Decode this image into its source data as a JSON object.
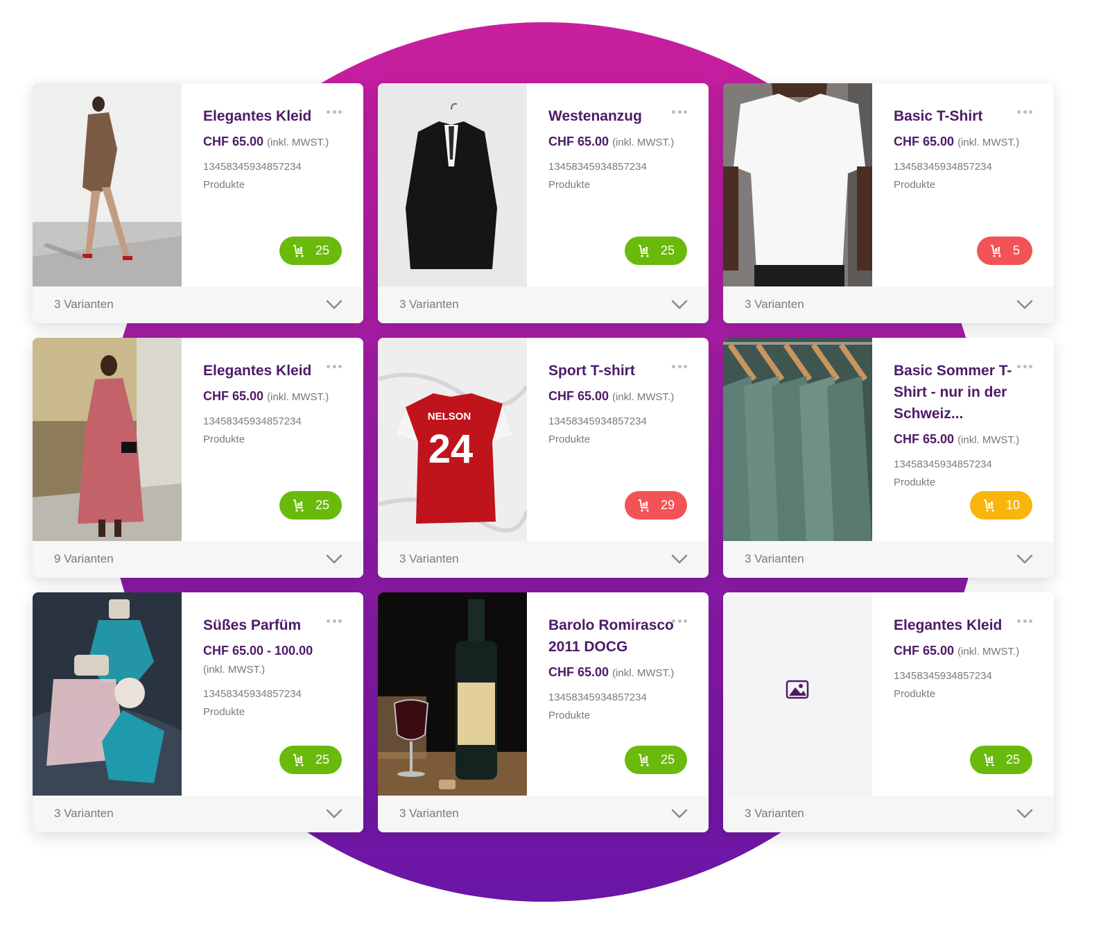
{
  "colors": {
    "accent": "#4e1a68",
    "stock_green": "#6aba0c",
    "stock_red": "#f25356",
    "stock_yellow": "#f8b50c",
    "background_gradient": [
      "#c91f9e",
      "#6a16a6"
    ]
  },
  "products": [
    {
      "title": "Elegantes Kleid",
      "price": "CHF 65.00",
      "tax": "(inkl. MWST.)",
      "sku": "13458345934857234",
      "category": "Produkte",
      "stock": "25",
      "stock_status": "green",
      "variants": "3 Varianten",
      "image": "woman-brown-dress-photo"
    },
    {
      "title": "Westenanzug",
      "price": "CHF 65.00",
      "tax": "(inkl. MWST.)",
      "sku": "13458345934857234",
      "category": "Produkte",
      "stock": "25",
      "stock_status": "green",
      "variants": "3 Varianten",
      "image": "black-suit-jacket-photo"
    },
    {
      "title": "Basic T-Shirt",
      "price": "CHF 65.00",
      "tax": "(inkl. MWST.)",
      "sku": "13458345934857234",
      "category": "Produkte",
      "stock": "5",
      "stock_status": "red",
      "variants": "3 Varianten",
      "image": "white-tshirt-photo"
    },
    {
      "title": "Elegantes Kleid",
      "price": "CHF 65.00",
      "tax": "(inkl. MWST.)",
      "sku": "13458345934857234",
      "category": "Produkte",
      "stock": "25",
      "stock_status": "green",
      "variants": "9 Varianten",
      "image": "woman-pink-dress-photo"
    },
    {
      "title": "Sport T-shirt",
      "price": "CHF 65.00",
      "tax": "(inkl. MWST.)",
      "sku": "13458345934857234",
      "category": "Produkte",
      "stock": "29",
      "stock_status": "red",
      "variants": "3 Varianten",
      "image": "red-jersey-photo",
      "jersey_name": "NELSON",
      "jersey_number": "24"
    },
    {
      "title": "Basic Sommer T-Shirt - nur in der Schweiz...",
      "price": "CHF 65.00",
      "tax": "(inkl. MWST.)",
      "sku": "13458345934857234",
      "category": "Produkte",
      "stock": "10",
      "stock_status": "yellow",
      "variants": "3 Varianten",
      "image": "green-tshirts-hangers-photo"
    },
    {
      "title": "Süßes Parfüm",
      "price": "CHF 65.00 - 100.00",
      "tax": "(inkl. MWST.)",
      "tax_below": true,
      "sku": "13458345934857234",
      "category": "Produkte",
      "stock": "25",
      "stock_status": "green",
      "variants": "3 Varianten",
      "image": "perfume-bottles-photo"
    },
    {
      "title": "Barolo Romirasco 2011 DOCG",
      "price": "CHF 65.00",
      "tax": "(inkl. MWST.)",
      "sku": "13458345934857234",
      "category": "Produkte",
      "stock": "25",
      "stock_status": "green",
      "variants": "3 Varianten",
      "image": "wine-bottle-glass-photo"
    },
    {
      "title": "Elegantes Kleid",
      "price": "CHF 65.00",
      "tax": "(inkl. MWST.)",
      "sku": "13458345934857234",
      "category": "Produkte",
      "stock": "25",
      "stock_status": "green",
      "variants": "3 Varianten",
      "image": "image-placeholder-icon"
    }
  ]
}
